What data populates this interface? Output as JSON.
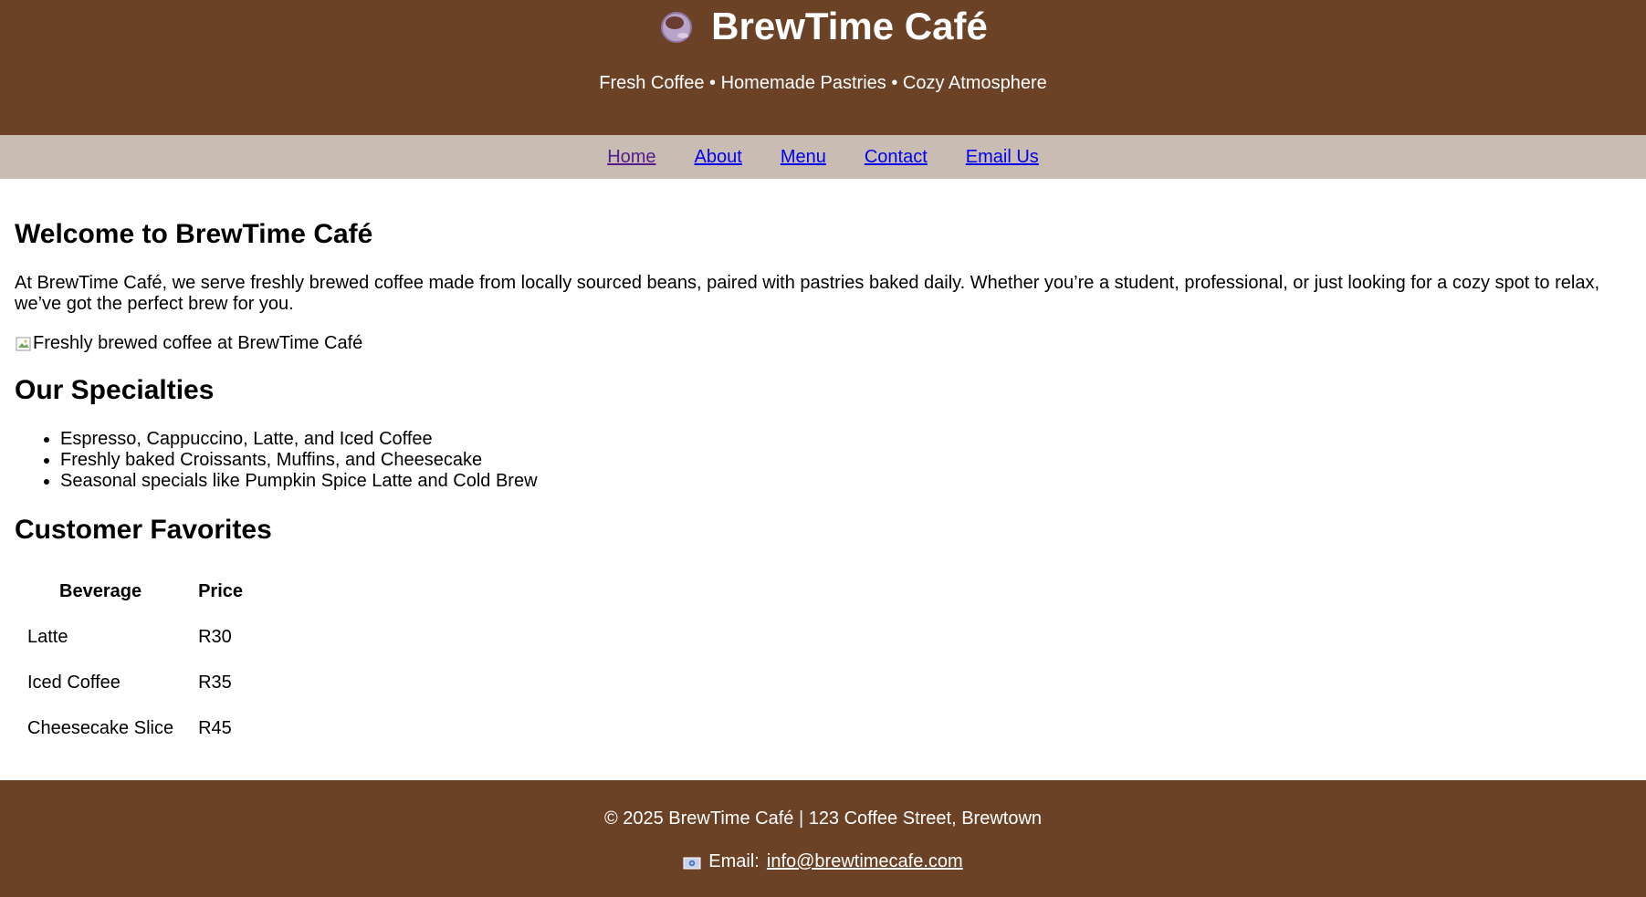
{
  "header": {
    "title": "BrewTime Café",
    "tagline": "Fresh Coffee • Homemade Pastries • Cozy Atmosphere",
    "icon": "coffee-cup-icon"
  },
  "nav": {
    "items": [
      "Home",
      "About",
      "Menu",
      "Contact",
      "Email Us"
    ]
  },
  "welcome": {
    "heading": "Welcome to BrewTime Café",
    "text": "At BrewTime Café, we serve freshly brewed coffee made from locally sourced beans, paired with pastries baked daily. Whether you’re a student, professional, or just looking for a cozy spot to relax, we’ve got the perfect brew for you.",
    "image_alt": "Freshly brewed coffee at BrewTime Café"
  },
  "specialties": {
    "heading": "Our Specialties",
    "items": [
      "Espresso, Cappuccino, Latte, and Iced Coffee",
      "Freshly baked Croissants, Muffins, and Cheesecake",
      "Seasonal specials like Pumpkin Spice Latte and Cold Brew"
    ]
  },
  "favorites": {
    "heading": "Customer Favorites",
    "columns": [
      "Beverage",
      "Price"
    ],
    "rows": [
      [
        "Latte",
        "R30"
      ],
      [
        "Iced Coffee",
        "R35"
      ],
      [
        "Cheesecake Slice",
        "R45"
      ]
    ]
  },
  "footer": {
    "copyright": "© 2025 BrewTime Café | 123 Coffee Street, Brewtown",
    "email_label": "Email:",
    "email": "info@brewtimecafe.com",
    "icon": "mail-icon"
  },
  "colors": {
    "brand_brown": "#6b4226",
    "nav_background": "#c9bdb3",
    "link": "#0000ee",
    "visited_link": "#551a8b"
  }
}
